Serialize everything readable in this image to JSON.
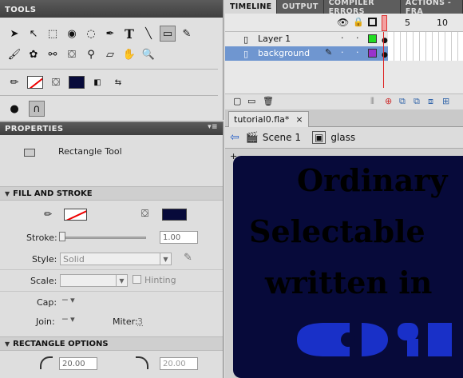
{
  "tools_panel": {
    "title": "TOOLS",
    "stroke_color": "#ffffff",
    "fill_color": "#070a3a"
  },
  "properties": {
    "title": "PROPERTIES",
    "tool_name": "Rectangle Tool",
    "fill_and_stroke": {
      "header": "FILL AND STROKE",
      "stroke_label": "Stroke:",
      "stroke_value": "1.00",
      "stroke_slider_fraction": 0.0,
      "style_label": "Style:",
      "style_value": "Solid",
      "scale_label": "Scale:",
      "scale_value": "",
      "hinting_label": "Hinting",
      "cap_label": "Cap:",
      "join_label": "Join:",
      "miter_label": "Miter:",
      "miter_value": "3"
    },
    "rectangle_options": {
      "header": "RECTANGLE OPTIONS",
      "corner_1": "20.00",
      "corner_2": "20.00"
    }
  },
  "timeline": {
    "tabs": [
      "TIMELINE",
      "OUTPUT",
      "COMPILER ERRORS",
      "ACTIONS - FRA"
    ],
    "frame_5": "5",
    "frame_10": "10",
    "layers": [
      {
        "name": "Layer 1",
        "color": "#22dd22",
        "selected": false
      },
      {
        "name": "background",
        "color": "#9933cc",
        "selected": true
      }
    ]
  },
  "document": {
    "tab_label": "tutorial0.fla*",
    "tab_close": "×",
    "scene_label": "Scene 1",
    "symbol_label": "glass",
    "stage_color": "#070a3a",
    "stage_lines": [
      "Ordinary",
      "Selectable",
      "written in"
    ]
  }
}
